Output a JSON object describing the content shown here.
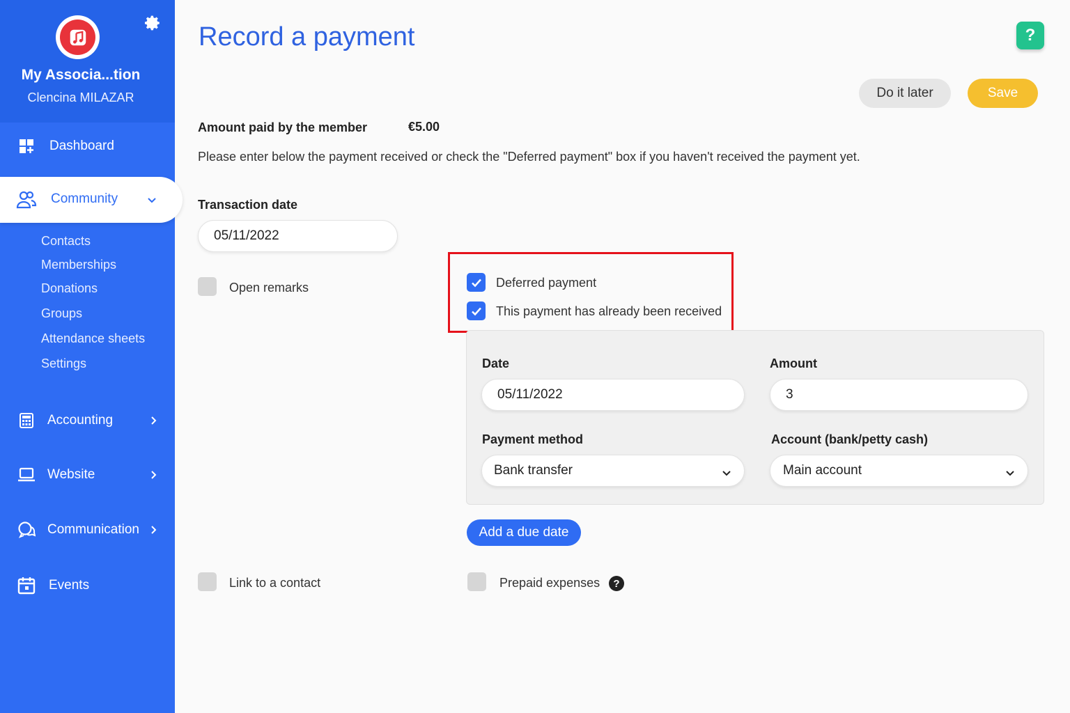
{
  "sidebar": {
    "org_name": "My Associa...tion",
    "user_name": "Clencina MILAZAR",
    "items": [
      {
        "label": "Dashboard",
        "icon": "dashboard-icon"
      },
      {
        "label": "Community",
        "icon": "users-icon",
        "active": true
      },
      {
        "label": "Accounting",
        "icon": "calculator-icon"
      },
      {
        "label": "Website",
        "icon": "laptop-icon"
      },
      {
        "label": "Communication",
        "icon": "chat-icon"
      },
      {
        "label": "Events",
        "icon": "calendar-icon"
      }
    ],
    "community_sub": [
      "Contacts",
      "Memberships",
      "Donations",
      "Groups",
      "Attendance sheets",
      "Settings"
    ]
  },
  "header": {
    "title": "Record a payment",
    "help": "?",
    "later_label": "Do it later",
    "save_label": "Save"
  },
  "form": {
    "amount_label": "Amount paid by the member",
    "amount_value": "€5.00",
    "instruction": "Please enter below the payment received or check the \"Deferred payment\" box if you haven't received the payment yet.",
    "transaction_date_label": "Transaction date",
    "transaction_date": "05/11/2022",
    "open_remarks": "Open remarks",
    "deferred_payment": "Deferred payment",
    "already_received": "This payment has already been received",
    "payment": {
      "date_label": "Date",
      "date": "05/11/2022",
      "amount_label": "Amount",
      "amount": "3",
      "method_label": "Payment method",
      "method": "Bank transfer",
      "account_label": "Account (bank/petty cash)",
      "account": "Main account"
    },
    "add_due_date": "Add a due date",
    "link_contact": "Link to a contact",
    "prepaid_expenses": "Prepaid expenses",
    "prepaid_help": "?"
  },
  "colors": {
    "sidebar": "#2f6cf3",
    "accent": "#2f62e0",
    "save": "#f5bf2f",
    "help": "#23c38e",
    "highlight": "#e5121b"
  }
}
